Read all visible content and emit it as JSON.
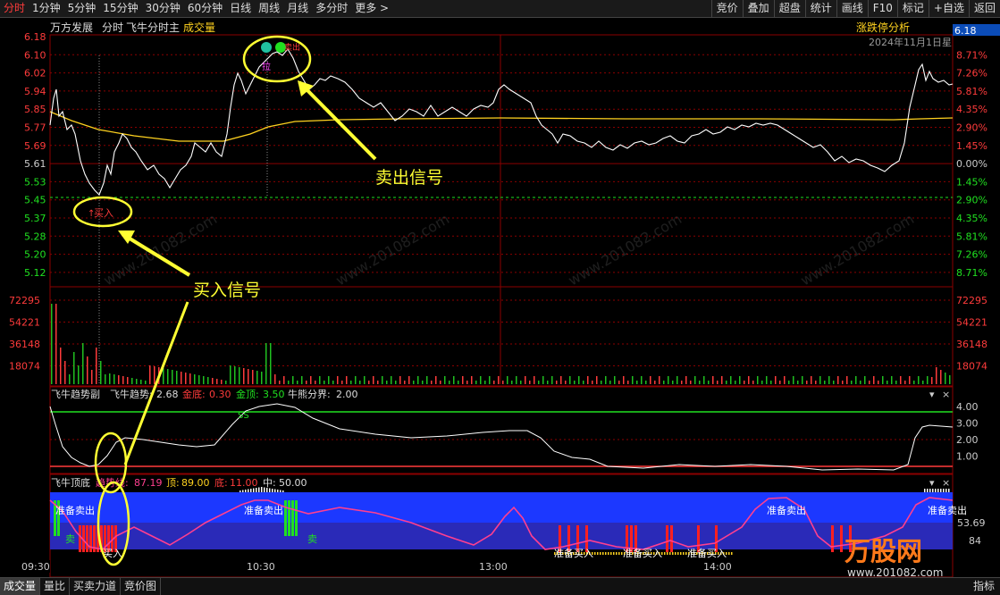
{
  "toolbar": {
    "tabs": [
      "分时",
      "1分钟",
      "5分钟",
      "15分钟",
      "30分钟",
      "60分钟",
      "日线",
      "周线",
      "月线",
      "多分时",
      "更多 >"
    ],
    "right_buttons": [
      "竞价",
      "叠加",
      "超盘",
      "统计",
      "画线",
      "F10",
      "标记",
      "+自选",
      "返回"
    ]
  },
  "info": {
    "stock_name": "万方发展",
    "mode": "分时",
    "indicator_main": "飞牛分时主",
    "volume_label": "成交量",
    "analysis_label": "涨跌停分析",
    "date": "2024年11月1日星",
    "corner_price": "6.18"
  },
  "price_axis": {
    "left": [
      "6.18",
      "6.10",
      "6.02",
      "5.94",
      "5.85",
      "5.77",
      "5.69",
      "5.61",
      "5.53",
      "5.45",
      "5.37",
      "5.28",
      "5.20",
      "5.12"
    ],
    "right": [
      "8.71%",
      "7.26%",
      "5.81%",
      "4.35%",
      "2.90%",
      "1.45%",
      "0.00%",
      "1.45%",
      "2.90%",
      "4.35%",
      "5.81%",
      "7.26%",
      "8.71%"
    ]
  },
  "volume_axis": [
    "72295",
    "54221",
    "36148",
    "18074"
  ],
  "panel1": {
    "title": "飞牛趋势副",
    "trend_label": "飞牛趋势:",
    "trend_value": "2.68",
    "gold_bottom_label": "金底:",
    "gold_bottom_value": "0.30",
    "gold_top_label": "金顶:",
    "gold_top_value": "3.50",
    "bull_label": "牛熊分界:",
    "bull_value": "2.00",
    "axis": [
      "4.00",
      "3.00",
      "2.00",
      "1.00"
    ],
    "ss_mark": "SS"
  },
  "panel2": {
    "title": "飞牛顶底",
    "trend_label": "趋势线:",
    "trend_value": "87.19",
    "top_label": "顶:",
    "top_value": "89.00",
    "bottom_label": "底:",
    "bottom_value": "11.00",
    "mid_label": "中:",
    "mid_value": "50.00",
    "axis": [
      "53.69",
      "84"
    ],
    "prepare_sell": "准备卖出",
    "prepare_buy": "准备买入",
    "sell_mark": "卖",
    "buy_mark": "买入",
    "small_mark": "买"
  },
  "time_axis": [
    "09:30",
    "10:30",
    "13:00",
    "14:00"
  ],
  "annotations": {
    "buy_signal": "买入信号",
    "sell_signal": "卖出信号",
    "buy_tag": "买入",
    "sell_tag": "拉",
    "top_tag": "卖出"
  },
  "watermark": {
    "brand": "万股网",
    "url": "www.201082.com"
  },
  "bottom_tabs": [
    "成交量",
    "量比",
    "买卖力道",
    "竞价图"
  ],
  "bottom_right": "指标",
  "colors": {
    "up": "#ff3b3b",
    "down": "#20d020",
    "price_line": "#ffffff",
    "avg_line": "#ffd21f",
    "grid": "#8b0000",
    "annotation": "#ffff33"
  }
}
